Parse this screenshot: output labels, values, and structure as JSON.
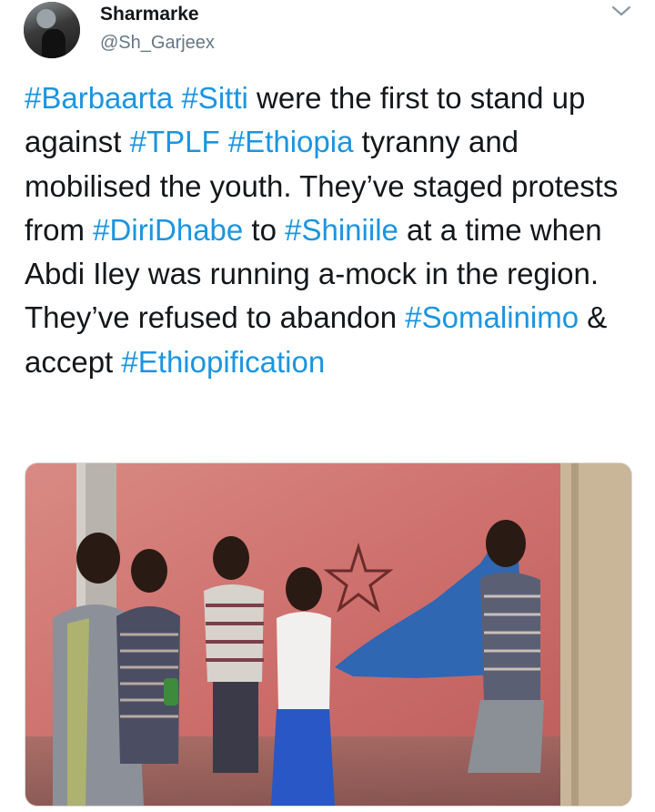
{
  "author": {
    "name": "Sharmarke",
    "handle": "@Sh_Garjeex"
  },
  "tweet": {
    "segments": [
      {
        "text": "#Barbaarta",
        "type": "hashtag"
      },
      {
        "text": " ",
        "type": "text"
      },
      {
        "text": "#Sitti",
        "type": "hashtag"
      },
      {
        "text": " were the first to stand up against ",
        "type": "text"
      },
      {
        "text": "#TPLF",
        "type": "hashtag"
      },
      {
        "text": " ",
        "type": "text"
      },
      {
        "text": "#Ethiopia",
        "type": "hashtag"
      },
      {
        "text": " tyranny and mobilised the youth. They’ve staged protests  from ",
        "type": "text"
      },
      {
        "text": "#DiriDhabe",
        "type": "hashtag"
      },
      {
        "text": " to ",
        "type": "text"
      },
      {
        "text": "#Shiniile",
        "type": "hashtag"
      },
      {
        "text": " at a time when Abdi Iley was running a-mock in the region. They’ve refused to abandon ",
        "type": "text"
      },
      {
        "text": "#Somalinimo",
        "type": "hashtag"
      },
      {
        "text": " & accept ",
        "type": "text"
      },
      {
        "text": "#Ethiopification",
        "type": "hashtag"
      }
    ]
  },
  "colors": {
    "hashtag": "#1b95e0",
    "text": "#14171a",
    "handle": "#657786"
  },
  "icons": {
    "menu": "chevron-down-icon",
    "avatar": "avatar"
  }
}
